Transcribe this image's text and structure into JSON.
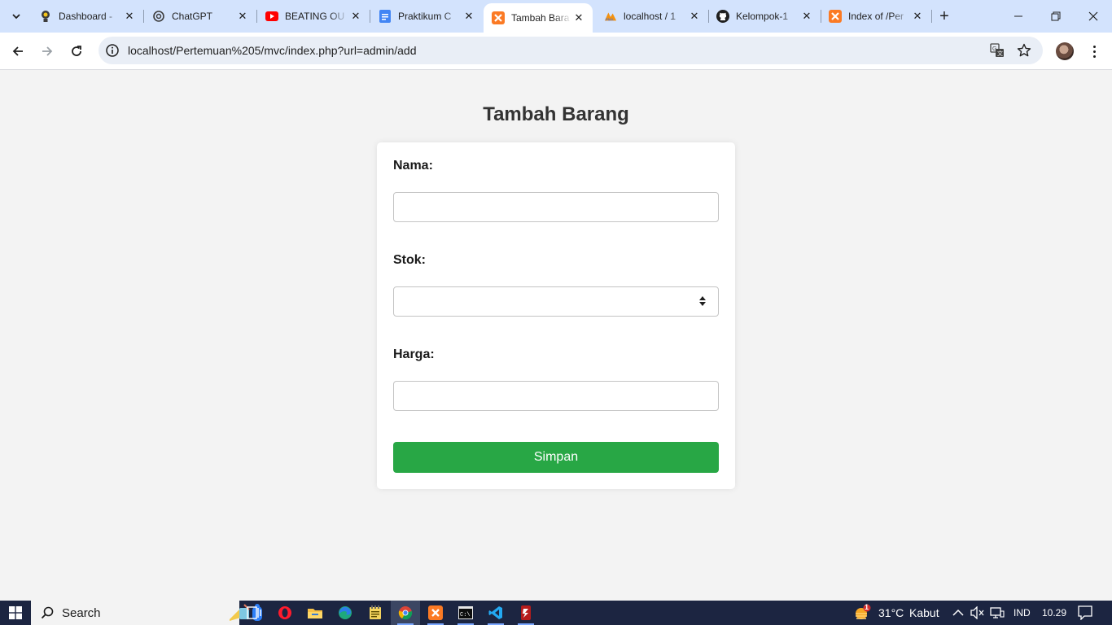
{
  "browser": {
    "tabs": [
      {
        "title": "Dashboard -",
        "icon": "bulb-icon",
        "active": false
      },
      {
        "title": "ChatGPT",
        "icon": "openai-icon",
        "active": false
      },
      {
        "title": "BEATING OU",
        "icon": "youtube-icon",
        "active": false
      },
      {
        "title": "Praktikum C",
        "icon": "docs-icon",
        "active": false
      },
      {
        "title": "Tambah Bara",
        "icon": "xampp-icon",
        "active": true
      },
      {
        "title": "localhost / 1",
        "icon": "phpmyadmin-icon",
        "active": false
      },
      {
        "title": "Kelompok-1",
        "icon": "github-icon",
        "active": false
      },
      {
        "title": "Index of /Per",
        "icon": "xampp-icon",
        "active": false
      }
    ],
    "close_glyph": "✕",
    "new_tab_glyph": "+",
    "url": "localhost/Pertemuan%205/mvc/index.php?url=admin/add"
  },
  "page": {
    "title": "Tambah Barang",
    "form": {
      "nama_label": "Nama:",
      "nama_value": "",
      "stok_label": "Stok:",
      "stok_value": "",
      "harga_label": "Harga:",
      "harga_value": "",
      "submit_label": "Simpan"
    }
  },
  "taskbar": {
    "search_placeholder": "Search",
    "weather_temp": "31°C",
    "weather_desc": "Kabut",
    "weather_badge": "1",
    "language": "IND",
    "clock": "10.29"
  },
  "colors": {
    "accent_green": "#28a745",
    "tabstrip_bg": "#d3e3fd",
    "taskbar_bg": "#1c2541",
    "page_bg": "#f3f3f3"
  }
}
